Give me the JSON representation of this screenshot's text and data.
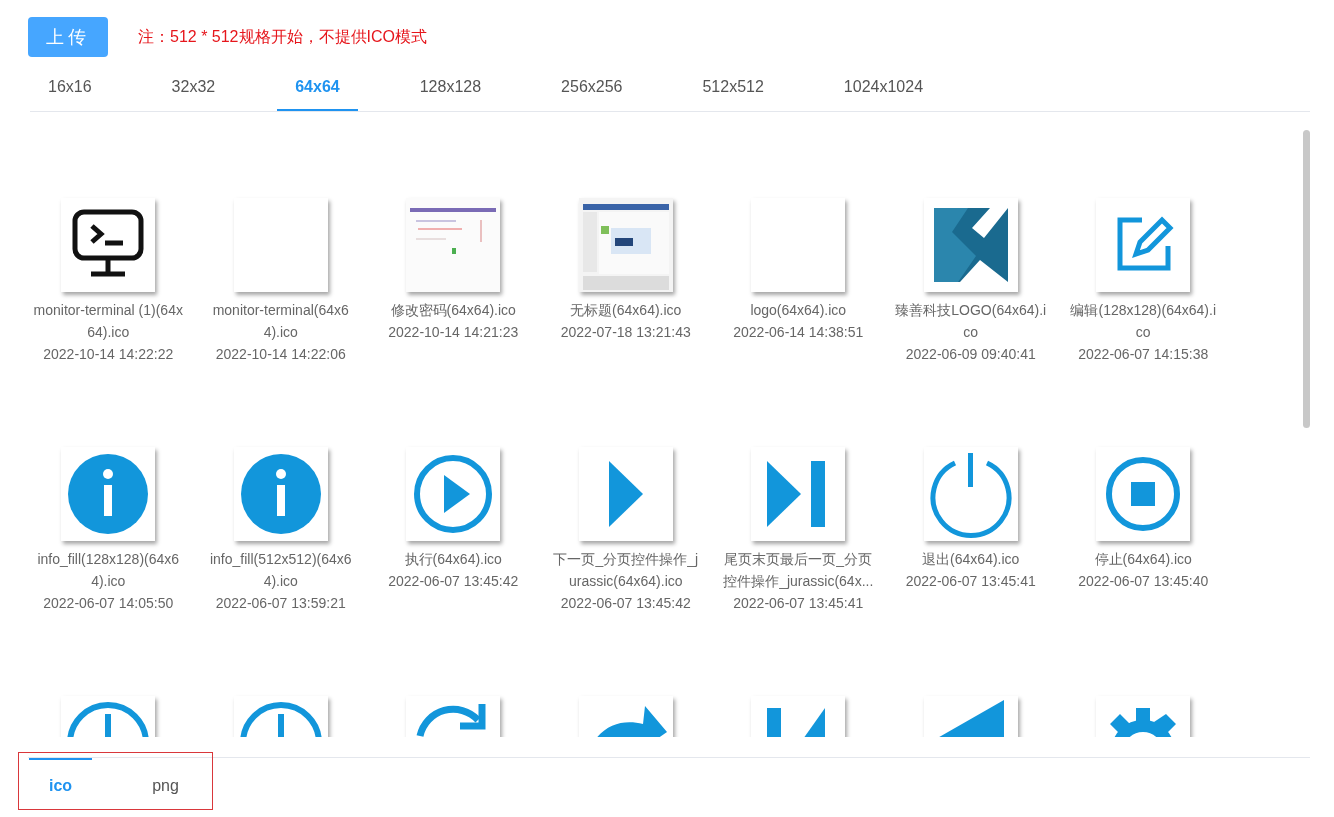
{
  "upload_button": "上传",
  "note": "注：512 * 512规格开始，不提供ICO模式",
  "size_tabs": [
    {
      "label": "16x16",
      "selected": false
    },
    {
      "label": "32x32",
      "selected": false
    },
    {
      "label": "64x64",
      "selected": true
    },
    {
      "label": "128x128",
      "selected": false
    },
    {
      "label": "256x256",
      "selected": false
    },
    {
      "label": "512x512",
      "selected": false
    },
    {
      "label": "1024x1024",
      "selected": false
    }
  ],
  "files": [
    {
      "kind": "terminal",
      "name": "monitor-terminal (1)(64x64).ico",
      "date": "2022-10-14 14:22:22"
    },
    {
      "kind": "blank",
      "name": "monitor-terminal(64x64).ico",
      "date": "2022-10-14 14:22:06"
    },
    {
      "kind": "picture",
      "name": "修改密码(64x64).ico",
      "date": "2022-10-14 14:21:23"
    },
    {
      "kind": "picture",
      "name": "无标题(64x64).ico",
      "date": "2022-07-18 13:21:43"
    },
    {
      "kind": "blank",
      "name": "logo(64x64).ico",
      "date": "2022-06-14 14:38:51"
    },
    {
      "kind": "logo",
      "name": "臻善科技LOGO(64x64).ico",
      "date": "2022-06-09 09:40:41"
    },
    {
      "kind": "edit",
      "name": "编辑(128x128)(64x64).ico",
      "date": "2022-06-07 14:15:38"
    },
    {
      "kind": "info",
      "name": "info_fill(128x128)(64x64).ico",
      "date": "2022-06-07 14:05:50"
    },
    {
      "kind": "info",
      "name": "info_fill(512x512)(64x64).ico",
      "date": "2022-06-07 13:59:21"
    },
    {
      "kind": "play-circle",
      "name": "执行(64x64).ico",
      "date": "2022-06-07 13:45:42"
    },
    {
      "kind": "play",
      "name": "下一页_分页控件操作_jurassic(64x64).ico",
      "date": "2022-06-07 13:45:42"
    },
    {
      "kind": "skip-end",
      "name": "尾页末页最后一页_分页控件操作_jurassic(64x...",
      "date": "2022-06-07 13:45:41"
    },
    {
      "kind": "power",
      "name": "退出(64x64).ico",
      "date": "2022-06-07 13:45:41"
    },
    {
      "kind": "stop",
      "name": "停止(64x64).ico",
      "date": "2022-06-07 13:45:40"
    },
    {
      "kind": "clock"
    },
    {
      "kind": "clock"
    },
    {
      "kind": "redo"
    },
    {
      "kind": "forward"
    },
    {
      "kind": "skip-start"
    },
    {
      "kind": "prev"
    },
    {
      "kind": "gear"
    }
  ],
  "format_tabs": [
    {
      "label": "ico",
      "selected": true
    },
    {
      "label": "png",
      "selected": false
    }
  ]
}
